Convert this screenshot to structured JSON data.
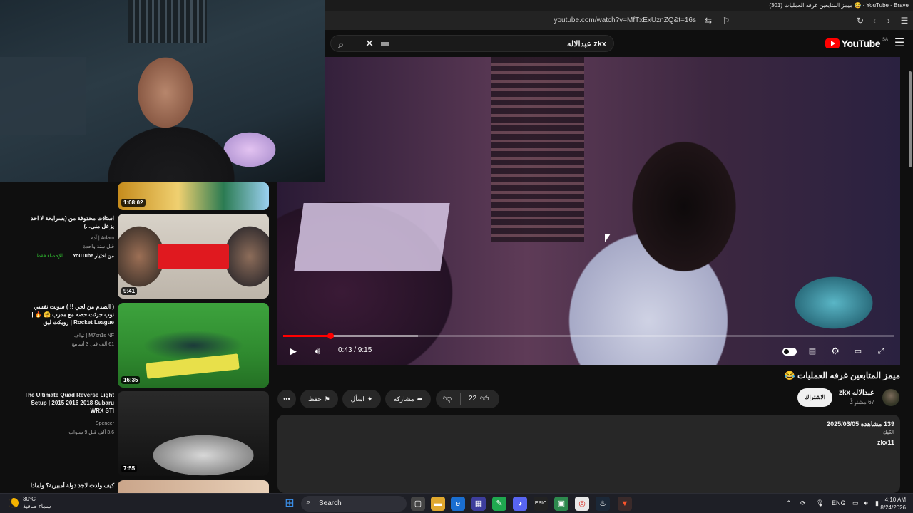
{
  "window": {
    "title": "(301) ميمز المتابعين غرفه العمليات 😂 - YouTube - Brave"
  },
  "addressbar": {
    "url": "youtube.com/watch?v=MfTxExUznZQ&t=16s"
  },
  "youtube": {
    "search_query": "عبدالاله zkx",
    "logo_text": "YouTube",
    "logo_country": "SA"
  },
  "player": {
    "time_current": "0:43",
    "time_total": "9:15",
    "time_display": "0:43 / 9:15",
    "progress_fraction": 0.077,
    "buffer_fraction": 0.22
  },
  "video": {
    "title": "ميمز المتابعين غرفه العمليات 😂",
    "channel_name": "عبدالاله zkx",
    "channel_subs": "67 مشترِكًا",
    "subscribe_label": "الاشتراك",
    "likes": "22",
    "share_label": "مشاركة",
    "ask_label": "اسأل",
    "save_label": "حفظ",
    "more_label": "•••",
    "description": {
      "stats": "139 مشاهدة   2025/03/05",
      "line2": "الكيك",
      "line3": "zkx11"
    }
  },
  "recommendations": [
    {
      "duration": "1:08:02",
      "title": "",
      "channel": "",
      "meta": ""
    },
    {
      "duration": "9:41",
      "title": "اسئلات محذوفة من (بسرابحة لا احد يزعل مني...)",
      "channel": "Adam | آدم",
      "meta": "قبل سنة واحدة",
      "extra": "من اختيار YouTube",
      "extra_badge": "الإحصاء فقط"
    },
    {
      "duration": "16:35",
      "title": "( الصدم من لحي !! ) سويت نفسي نوب جزئت حصه مع مدرب 🤗 🔥 | Rocket League | رويكت ليق",
      "channel": "M7sn1s NF | نواف",
      "meta": "61 ألف  قبل 3 أسابيع"
    },
    {
      "duration": "7:55",
      "title": "The Ultimate Quad Reverse Light Setup | 2015 2016 2018 Subaru WRX STI",
      "channel": "Spencer",
      "meta": "3.6 ألف  قبل 9 سنوات"
    },
    {
      "duration": "",
      "title": "كيف ولدت لاجد دولة أمبيرية؟ ولماذا",
      "channel": "",
      "meta": ""
    }
  ],
  "taskbar": {
    "weather_temp": "30°C",
    "weather_desc": "سماء صافية",
    "search_label": "Search",
    "lang": "ENG",
    "time": "4:10 AM",
    "date": "8/24/2026"
  },
  "colors": {
    "accent": "#ff0000",
    "bg": "#0f0f0f",
    "pill": "#272727"
  }
}
